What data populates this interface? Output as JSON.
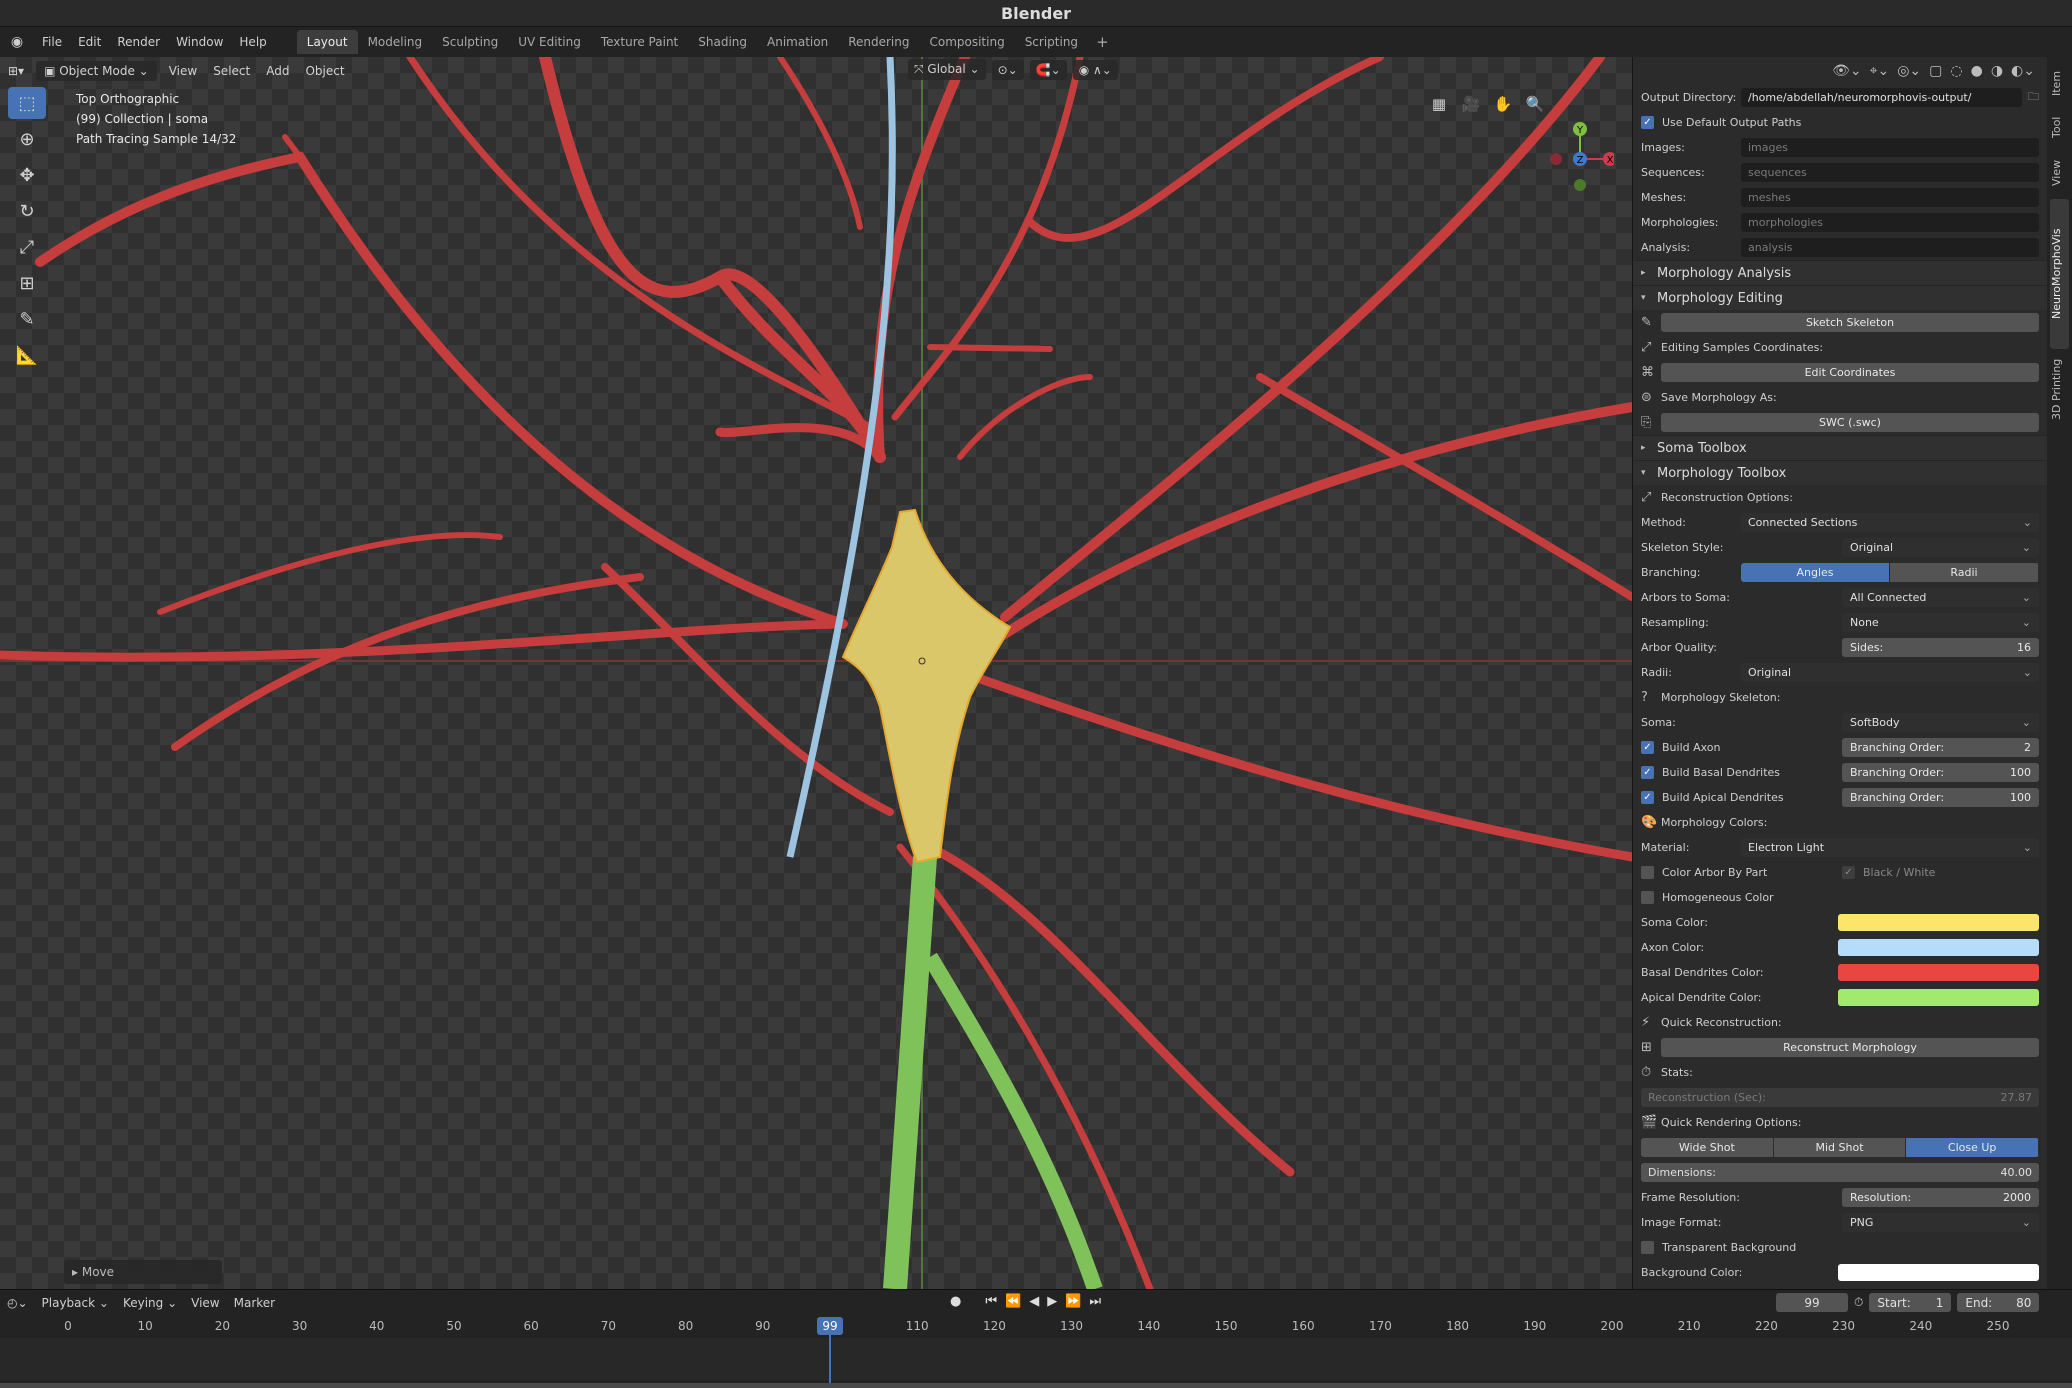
{
  "app": {
    "title": "Blender"
  },
  "menu": [
    "File",
    "Edit",
    "Render",
    "Window",
    "Help"
  ],
  "workspaces": [
    "Layout",
    "Modeling",
    "Sculpting",
    "UV Editing",
    "Texture Paint",
    "Shading",
    "Animation",
    "Rendering",
    "Compositing",
    "Scripting"
  ],
  "viewport": {
    "mode": "Object Mode",
    "menus": [
      "View",
      "Select",
      "Add",
      "Object"
    ],
    "transform_orientation": "Global",
    "info": [
      "Top Orthographic",
      "(99) Collection | soma",
      "Path Tracing Sample 14/32"
    ],
    "operator_panel": "Move",
    "gizmo": {
      "y": "Y",
      "z": "Z",
      "x": "X"
    }
  },
  "sidebar": {
    "output": {
      "directory_label": "Output Directory:",
      "directory_value": "/home/abdellah/neuromorphovis-output/",
      "use_default_label": "Use Default Output Paths",
      "paths": [
        {
          "label": "Images:",
          "value": "images"
        },
        {
          "label": "Sequences:",
          "value": "sequences"
        },
        {
          "label": "Meshes:",
          "value": "meshes"
        },
        {
          "label": "Morphologies:",
          "value": "morphologies"
        },
        {
          "label": "Analysis:",
          "value": "analysis"
        }
      ]
    },
    "panels": {
      "morphology_analysis": "Morphology Analysis",
      "morphology_editing": "Morphology Editing",
      "soma_toolbox": "Soma Toolbox",
      "morphology_toolbox": "Morphology Toolbox"
    },
    "editing": {
      "sketch": "Sketch Skeleton",
      "coords_label": "Editing Samples Coordinates:",
      "edit_coords": "Edit Coordinates",
      "save_label": "Save Morphology As:",
      "swc": "SWC (.swc)"
    },
    "toolbox": {
      "recon_label": "Reconstruction Options:",
      "method_label": "Method:",
      "method_value": "Connected Sections",
      "skeleton_style_label": "Skeleton Style:",
      "skeleton_style_value": "Original",
      "branching_label": "Branching:",
      "branching_a": "Angles",
      "branching_b": "Radii",
      "arbors_label": "Arbors to Soma:",
      "arbors_value": "All Connected",
      "resampling_label": "Resampling:",
      "resampling_value": "None",
      "arbor_quality_label": "Arbor Quality:",
      "sides_label": "Sides:",
      "sides_value": "16",
      "radii_label": "Radii:",
      "radii_value": "Original",
      "skeleton_label": "Morphology Skeleton:",
      "soma_label": "Soma:",
      "soma_value": "SoftBody",
      "build_axon": "Build Axon",
      "axon_order": "2",
      "build_basal": "Build Basal Dendrites",
      "basal_order": "100",
      "build_apical": "Build Apical Dendrites",
      "apical_order": "100",
      "branching_order_label": "Branching Order:",
      "colors_label": "Morphology Colors:",
      "material_label": "Material:",
      "material_value": "Electron Light",
      "color_by_part": "Color Arbor By Part",
      "black_white": "Black / White",
      "homogeneous": "Homogeneous Color",
      "soma_color_label": "Soma Color:",
      "axon_color_label": "Axon Color:",
      "basal_color_label": "Basal Dendrites  Color:",
      "apical_color_label": "Apical Dendrite Color:",
      "quick_recon_label": "Quick Reconstruction:",
      "reconstruct": "Reconstruct Morphology",
      "stats_label": "Stats:",
      "recon_time_label": "Reconstruction (Sec):",
      "recon_time_value": "27.87",
      "quick_render_label": "Quick Rendering Options:",
      "wide": "Wide Shot",
      "mid": "Mid Shot",
      "close": "Close Up",
      "dimensions_label": "Dimensions:",
      "dimensions_value": "40.00",
      "frame_res_label": "Frame Resolution:",
      "resolution_label": "Resolution:",
      "resolution_value": "2000",
      "image_format_label": "Image Format:",
      "image_format_value": "PNG",
      "transparent": "Transparent Background",
      "bg_color_label": "Background Color:"
    },
    "colors": {
      "soma": "#fde46a",
      "axon": "#b4dcfb",
      "basal": "#e8463f",
      "apical": "#a2ea6c",
      "background": "#ffffff"
    }
  },
  "tabs": [
    "Item",
    "Tool",
    "View",
    "NeuroMorphoVis",
    "3D Printing"
  ],
  "timeline": {
    "menus": [
      "Playback",
      "Keying",
      "View",
      "Marker"
    ],
    "current_frame": "99",
    "start_label": "Start:",
    "start": "1",
    "end_label": "End:",
    "end": "80",
    "ticks": [
      "0",
      "10",
      "20",
      "30",
      "40",
      "50",
      "60",
      "70",
      "80",
      "90",
      "110",
      "120",
      "130",
      "140",
      "150",
      "160",
      "170",
      "180",
      "190",
      "200",
      "210",
      "220",
      "230",
      "240",
      "250"
    ]
  },
  "scene_colors": {
    "dendrite": "#c63d3d",
    "soma": "#d9c76a",
    "axon": "#9cc3df",
    "apical": "#7fc25a"
  }
}
